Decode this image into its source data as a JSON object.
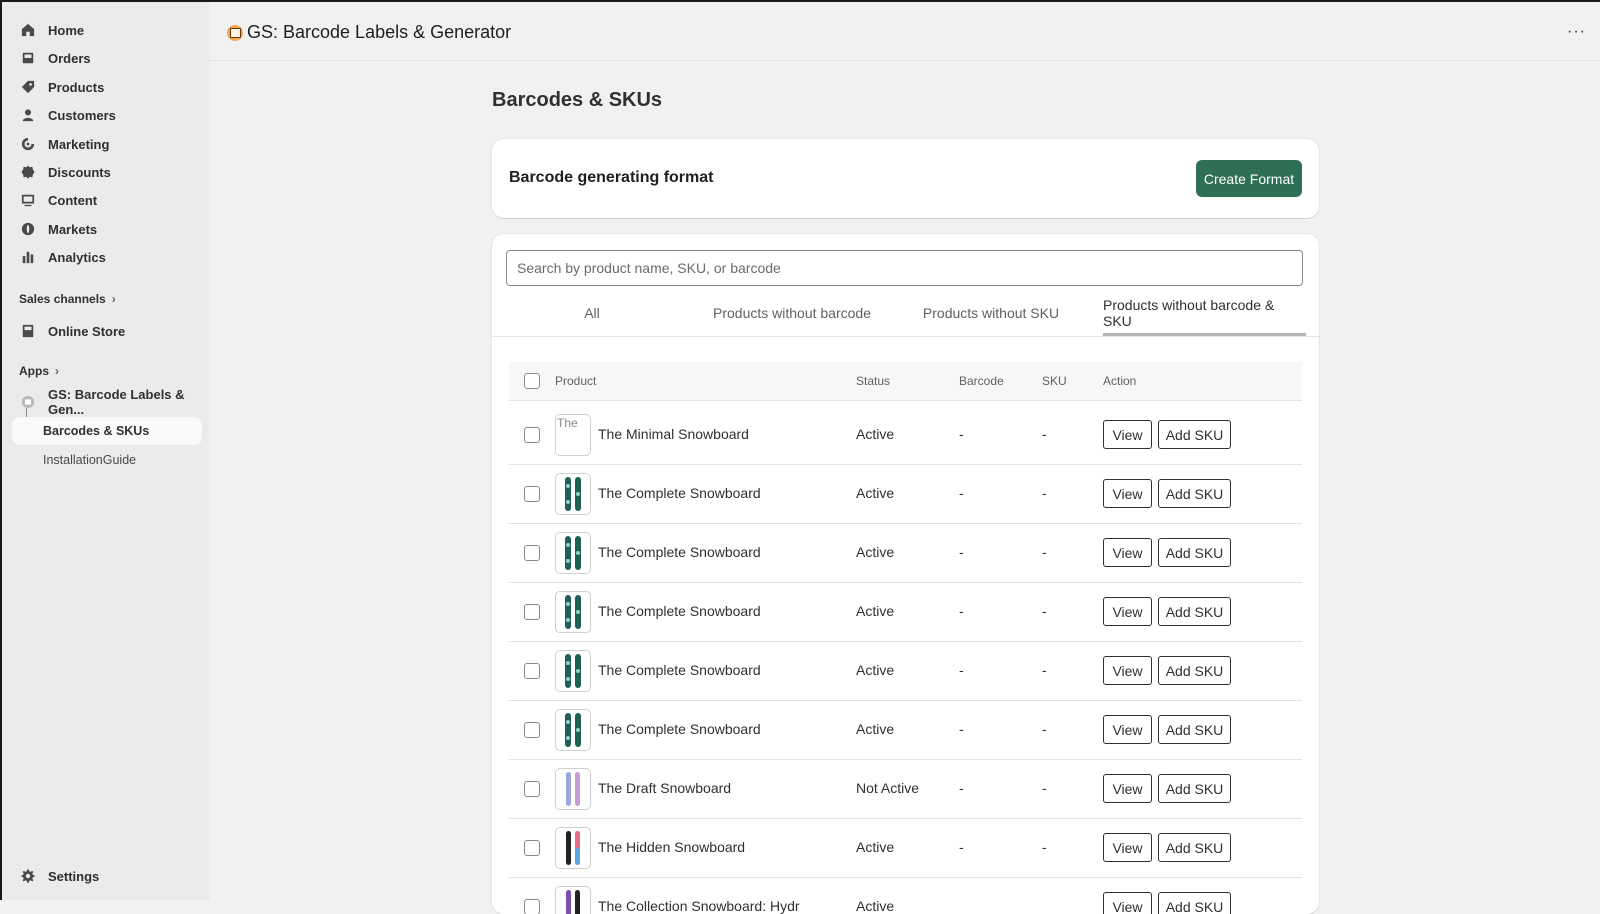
{
  "sidebar": {
    "nav": [
      {
        "label": "Home",
        "icon": "home-icon"
      },
      {
        "label": "Orders",
        "icon": "orders-icon"
      },
      {
        "label": "Products",
        "icon": "tag-icon"
      },
      {
        "label": "Customers",
        "icon": "person-icon"
      },
      {
        "label": "Marketing",
        "icon": "target-icon"
      },
      {
        "label": "Discounts",
        "icon": "discount-icon"
      },
      {
        "label": "Content",
        "icon": "content-icon"
      },
      {
        "label": "Markets",
        "icon": "globe-icon"
      },
      {
        "label": "Analytics",
        "icon": "bar-chart-icon"
      }
    ],
    "sales_channels_label": "Sales channels",
    "online_store_label": "Online Store",
    "apps_label": "Apps",
    "app_item_label": "GS: Barcode Labels & Gen...",
    "sub_items": [
      {
        "label": "Barcodes & SKUs",
        "active": true
      },
      {
        "label": "InstallationGuide",
        "active": false
      }
    ],
    "settings_label": "Settings"
  },
  "topbar": {
    "app_title": "GS: Barcode Labels & Generator",
    "more_label": "···"
  },
  "main": {
    "page_title": "Barcodes & SKUs",
    "format_card": {
      "title": "Barcode generating format",
      "create_button": "Create Format"
    },
    "search": {
      "placeholder": "Search by product name, SKU, or barcode"
    },
    "tabs": [
      {
        "label": "All",
        "active": false
      },
      {
        "label": "Products without barcode",
        "active": false
      },
      {
        "label": "Products without SKU",
        "active": false
      },
      {
        "label": "Products without barcode & SKU",
        "active": true
      }
    ],
    "columns": {
      "product": "Product",
      "status": "Status",
      "barcode": "Barcode",
      "sku": "SKU",
      "action": "Action"
    },
    "view_label": "View",
    "add_sku_label": "Add SKU",
    "broken_image_alt": "The",
    "rows": [
      {
        "name": "The Minimal Snowboard",
        "status": "Active",
        "barcode": "-",
        "sku": "-",
        "image": "broken"
      },
      {
        "name": "The Complete Snowboard",
        "status": "Active",
        "barcode": "-",
        "sku": "-",
        "image": "complete"
      },
      {
        "name": "The Complete Snowboard",
        "status": "Active",
        "barcode": "-",
        "sku": "-",
        "image": "complete"
      },
      {
        "name": "The Complete Snowboard",
        "status": "Active",
        "barcode": "-",
        "sku": "-",
        "image": "complete"
      },
      {
        "name": "The Complete Snowboard",
        "status": "Active",
        "barcode": "-",
        "sku": "-",
        "image": "complete"
      },
      {
        "name": "The Complete Snowboard",
        "status": "Active",
        "barcode": "-",
        "sku": "-",
        "image": "complete"
      },
      {
        "name": "The Draft Snowboard",
        "status": "Not Active",
        "barcode": "-",
        "sku": "-",
        "image": "draft"
      },
      {
        "name": "The Hidden Snowboard",
        "status": "Active",
        "barcode": "-",
        "sku": "-",
        "image": "hidden"
      },
      {
        "name": "The Collection Snowboard: Hydr",
        "status": "Active",
        "barcode": "",
        "sku": "",
        "image": "collection"
      }
    ]
  },
  "colors": {
    "primary_button": "#2e6f56",
    "sidebar_bg": "#ebebeb",
    "page_bg": "#f1f1f1"
  }
}
